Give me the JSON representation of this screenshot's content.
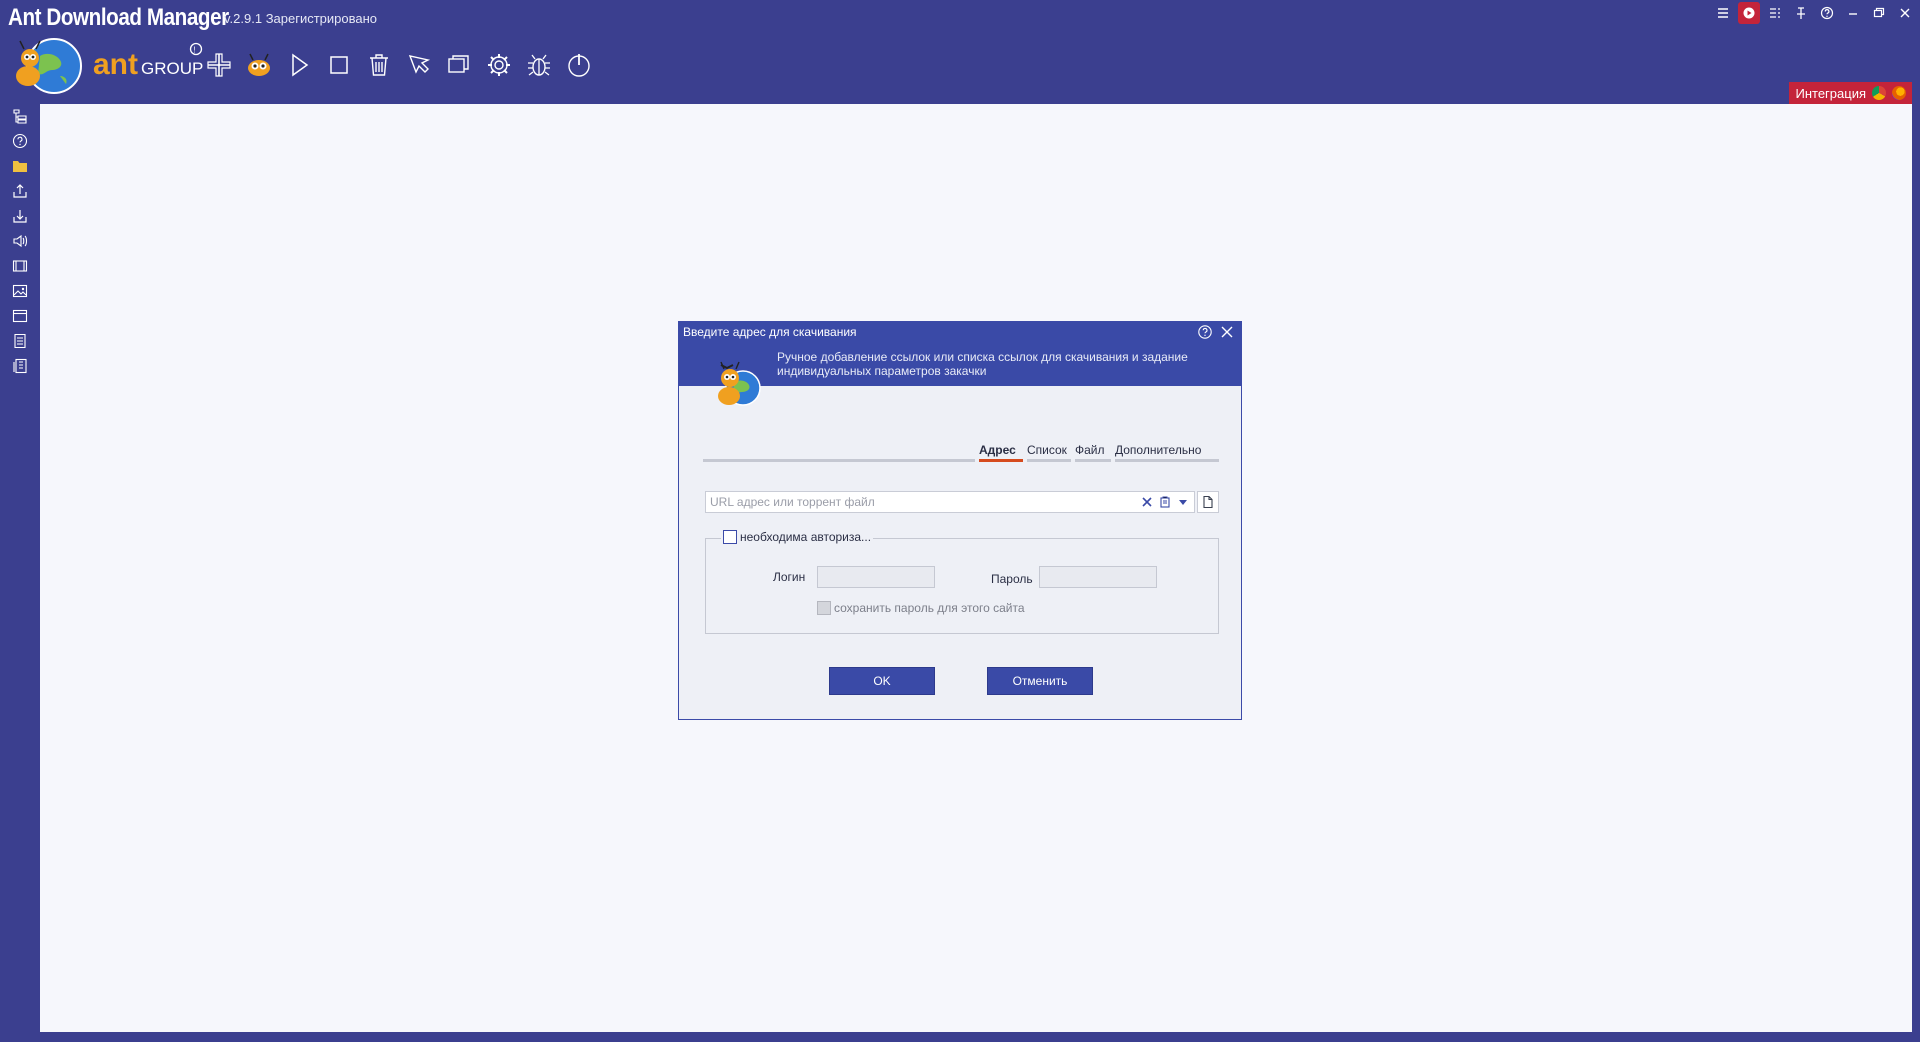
{
  "app": {
    "title": "Ant Download Manager",
    "version": "v.2.9.1",
    "status": "Зарегистрировано",
    "logo_text": "ant GROUP",
    "integration_label": "Интеграция"
  },
  "colors": {
    "chrome": "#3b3f8f",
    "dialog_header": "#3a4aa7",
    "accent_red": "#c4243a",
    "active_tab": "#d64b1e"
  },
  "window_controls": [
    "menu-icon",
    "record-icon",
    "list-settings-icon",
    "pin-icon",
    "help-icon",
    "minimize-icon",
    "restore-icon",
    "close-icon"
  ],
  "toolbar": [
    "add-icon",
    "ant-mascot-icon",
    "play-icon",
    "stop-icon",
    "delete-icon",
    "pen-icon",
    "windows-icon",
    "gear-icon",
    "bug-icon",
    "power-icon"
  ],
  "sidebar": [
    "tree-icon",
    "question-icon",
    "folder-icon",
    "upload-icon",
    "download-icon",
    "audio-icon",
    "video-icon",
    "image-icon",
    "window-icon",
    "document-icon",
    "archive-icon"
  ],
  "dialog": {
    "title": "Введите адрес для скачивания",
    "description": "Ручное добавление ссылок или списка ссылок для скачивания и задание индивидуальных параметров закачки",
    "tabs": [
      {
        "label": "Адрес",
        "active": true
      },
      {
        "label": "Список",
        "active": false
      },
      {
        "label": "Файл",
        "active": false
      },
      {
        "label": "Дополнительно",
        "active": false
      }
    ],
    "url_placeholder": "URL адрес или торрент файл",
    "url_value": "",
    "auth_checkbox_label": "необходима авториза...",
    "auth_checked": false,
    "login_label": "Логин",
    "login_value": "",
    "password_label": "Пароль",
    "password_value": "",
    "save_password_label": "сохранить пароль для этого сайта",
    "save_password_checked": false,
    "ok_label": "OK",
    "cancel_label": "Отменить"
  }
}
